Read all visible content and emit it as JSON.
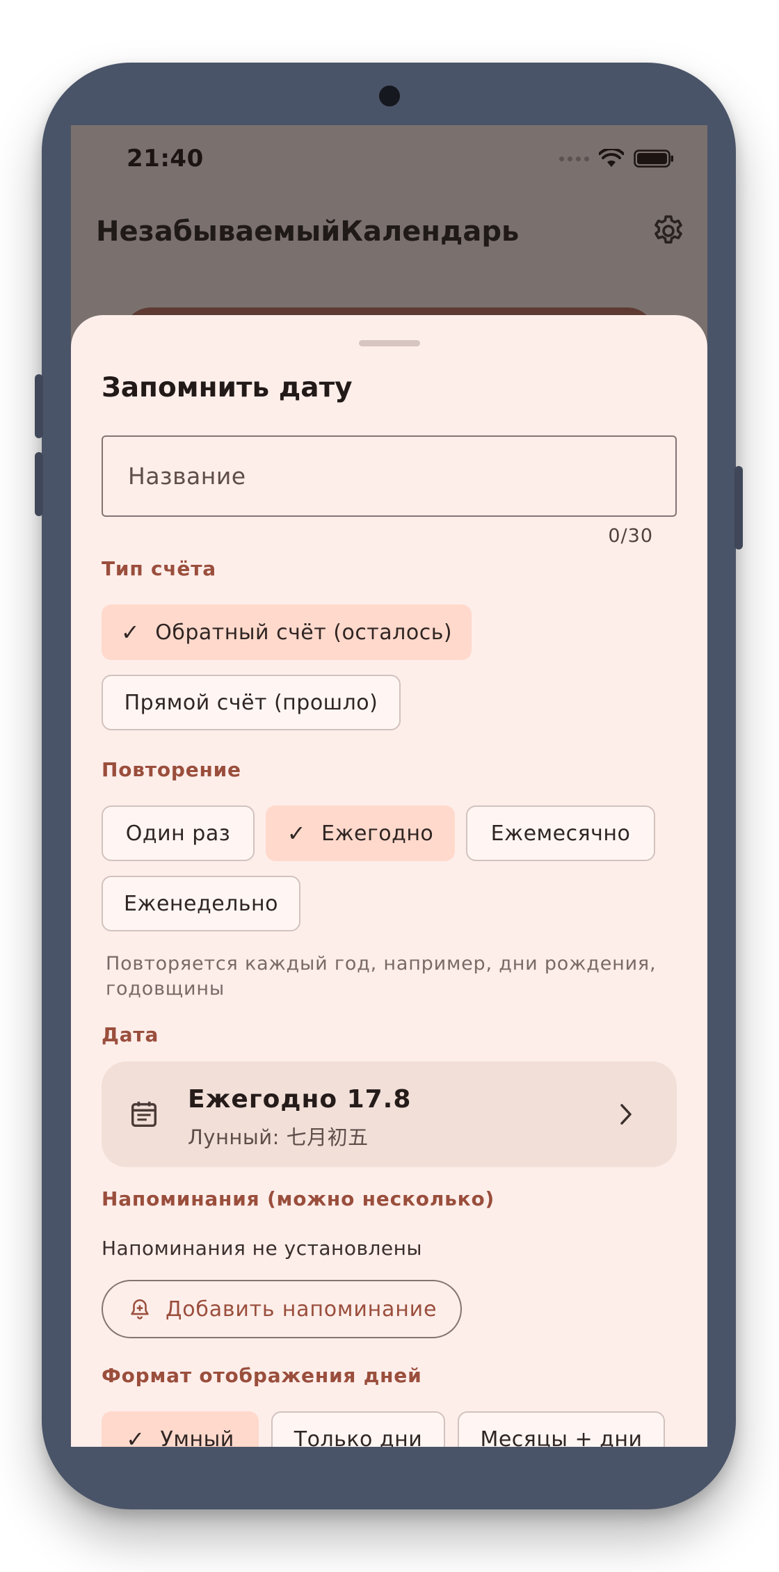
{
  "status": {
    "time": "21:40"
  },
  "app": {
    "title": "НезабываемыйКалендарь"
  },
  "sheet": {
    "title": "Запомнить дату",
    "name_field": {
      "placeholder": "Название",
      "value": "",
      "counter": "0/30"
    },
    "count_type": {
      "label": "Тип счёта",
      "options": [
        {
          "label": "Обратный счёт (осталось)",
          "selected": true
        },
        {
          "label": "Прямой счёт (прошло)",
          "selected": false
        }
      ]
    },
    "repeat": {
      "label": "Повторение",
      "options": [
        {
          "label": "Один раз",
          "selected": false
        },
        {
          "label": "Ежегодно",
          "selected": true
        },
        {
          "label": "Ежемесячно",
          "selected": false
        },
        {
          "label": "Еженедельно",
          "selected": false
        }
      ],
      "helper": "Повторяется каждый год, например, дни рождения, годовщины"
    },
    "date": {
      "label": "Дата",
      "title": "Ежегодно 17.8",
      "lunar": "Лунный:  七月初五"
    },
    "reminders": {
      "label": "Напоминания (можно несколько)",
      "empty_text": "Напоминания не установлены",
      "add_button": "Добавить напоминание"
    },
    "display_format": {
      "label": "Формат отображения дней",
      "options": [
        {
          "label": "Умный",
          "selected": true
        },
        {
          "label": "Только дни",
          "selected": false
        },
        {
          "label": "Месяцы + дни",
          "selected": false
        }
      ]
    }
  },
  "colors": {
    "sheet_bg": "#fdeeea",
    "accent": "#9a4e3c",
    "chip_selected": "#ffd9cc",
    "phone_frame": "#4a5468"
  }
}
